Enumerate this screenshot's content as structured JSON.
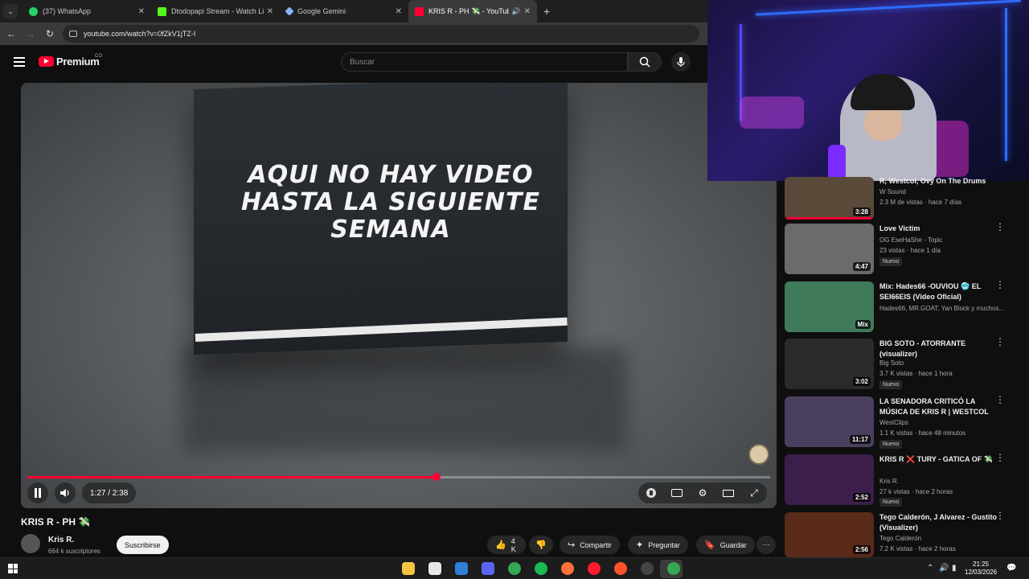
{
  "browser": {
    "tabs": [
      {
        "label": "(37) WhatsApp",
        "favicon_color": "#25d366"
      },
      {
        "label": "Dtodopapi Stream - Watch Live",
        "favicon_color": "#53fc18"
      },
      {
        "label": "Google Gemini",
        "favicon_color": "#8ab4f8"
      },
      {
        "label": "KRIS R - PH 💸 - YouTube",
        "favicon_color": "#ff0033",
        "active": true
      }
    ],
    "url": "youtube.com/watch?v=0fZkV1jTZ-I"
  },
  "youtube": {
    "logo_text": "Premium",
    "logo_country": "CO",
    "search_placeholder": "Buscar"
  },
  "player": {
    "overlay_text": "AQUI NO HAY VIDEO HASTA LA SIGUIENTE SEMANA",
    "current_time": "1:27",
    "duration": "2:38",
    "time_display": "1:27 / 2:38",
    "progress_fraction": 0.551
  },
  "video": {
    "title": "KRIS R - PH 💸",
    "channel": "Kris R.",
    "subscribers": "664 k suscriptores",
    "subscribe_label": "Suscribirse",
    "likes": "4 K",
    "share_label": "Compartir",
    "ask_label": "Preguntar",
    "save_label": "Guardar"
  },
  "recommendations": [
    {
      "title": "R, Westcol, Ovy On The Drums",
      "channel": "W Sound",
      "meta": "2.3 M de vistas · hace 7 días",
      "duration": "3:28",
      "badge": "",
      "thumb": "#5a4a3a",
      "watched": 1.0
    },
    {
      "title": "Love Victim",
      "channel": "OG EseHaShe - Topic",
      "meta": "23 vistas · hace 1 día",
      "duration": "4:47",
      "badge": "Nuevo",
      "thumb": "#6b6b6b",
      "watched": 0
    },
    {
      "title": "Mix: Hades66 -OUVIOU 🥶 EL SEI66EIS (Video Oficial)",
      "channel": "Hades66, MR.GOAT, Yan Block y muchos...",
      "meta": "",
      "duration": "Mix",
      "badge": "",
      "thumb": "#3f7a5a",
      "watched": 0
    },
    {
      "title": "BIG SOTO - ATORRANTE (visualizer)",
      "channel": "Big Soto",
      "meta": "3.7 K vistas · hace 1 hora",
      "duration": "3:02",
      "badge": "Nuevo",
      "thumb": "#2a2a2a",
      "watched": 0
    },
    {
      "title": "LA SENADORA CRITICÓ LA MÚSICA DE KRIS R | WESTCOL",
      "channel": "WestClips",
      "meta": "1.1 K vistas · hace 48 minutos",
      "duration": "11:17",
      "badge": "Nuevo",
      "thumb": "#4a3f5e",
      "watched": 0
    },
    {
      "title": "KRIS R ❌ TURY - GATICA OF 💸",
      "channel": "Kris R.",
      "meta": "27 k vistas · hace 2 horas",
      "duration": "2:52",
      "badge": "Nuevo",
      "thumb": "#3b1f4a",
      "watched": 0
    },
    {
      "title": "Tego Calderón, J Alvarez - Gustito (Visualizer)",
      "channel": "Tego Calderón",
      "meta": "7.2 K vistas · hace 2 horas",
      "duration": "2:56",
      "badge": "",
      "thumb": "#5a2a1a",
      "watched": 0
    }
  ],
  "taskbar": {
    "time": "21:25",
    "date": "12/03/2026",
    "apps": [
      {
        "name": "file-explorer-icon",
        "color": "#f5c542"
      },
      {
        "name": "store-icon",
        "color": "#e8e8e8"
      },
      {
        "name": "outlook-icon",
        "color": "#2f7fd6"
      },
      {
        "name": "discord-icon",
        "color": "#5865f2"
      },
      {
        "name": "chrome-icon",
        "color": "#34a853"
      },
      {
        "name": "spotify-icon",
        "color": "#1db954"
      },
      {
        "name": "firefox-icon",
        "color": "#ff7139"
      },
      {
        "name": "opera-icon",
        "color": "#ff1b2d"
      },
      {
        "name": "brave-icon",
        "color": "#fb542b"
      },
      {
        "name": "obs-icon",
        "color": "#444444"
      },
      {
        "name": "chrome-active-icon",
        "color": "#34a853"
      }
    ]
  }
}
